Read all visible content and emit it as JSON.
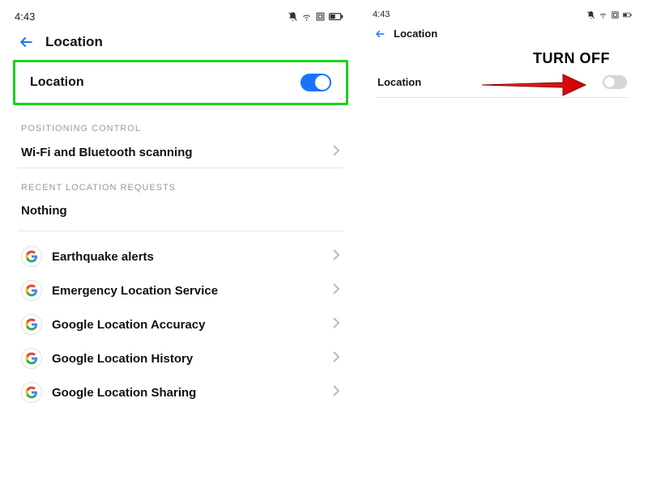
{
  "left": {
    "status": {
      "time": "4:43"
    },
    "header": {
      "title": "Location"
    },
    "location_row": {
      "label": "Location",
      "toggle_on": true
    },
    "sections": {
      "positioning": {
        "header": "POSITIONING CONTROL",
        "wifi_bt": "Wi-Fi and Bluetooth scanning"
      },
      "recent": {
        "header": "RECENT LOCATION REQUESTS",
        "nothing": "Nothing"
      }
    },
    "google_items": [
      {
        "label": "Earthquake alerts"
      },
      {
        "label": "Emergency Location Service"
      },
      {
        "label": "Google Location Accuracy"
      },
      {
        "label": "Google Location History"
      },
      {
        "label": "Google Location Sharing"
      }
    ]
  },
  "right": {
    "status": {
      "time": "4:43"
    },
    "header": {
      "title": "Location"
    },
    "location_row": {
      "label": "Location",
      "toggle_on": false
    }
  },
  "annotation": {
    "turn_off": "TURN OFF"
  }
}
